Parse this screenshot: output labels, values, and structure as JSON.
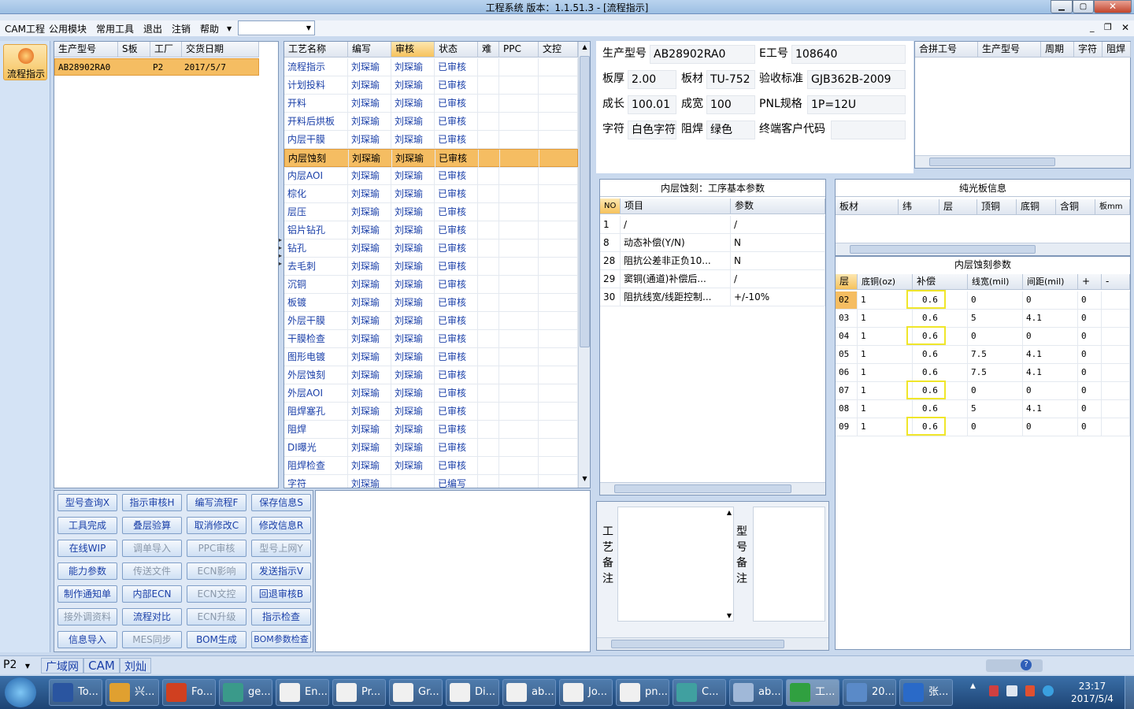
{
  "window": {
    "title": "工程系统   版本：1.1.51.3 - [流程指示]"
  },
  "menu": [
    "CAM工程",
    "公用模块",
    "常用工具",
    "退出",
    "注销",
    "帮助"
  ],
  "left_tool": {
    "label": "流程指示"
  },
  "order_table": {
    "headers": [
      "生产型号",
      "S板",
      "工厂",
      "交货日期"
    ],
    "row": [
      "AB28902RA0",
      "",
      "P2",
      "2017/5/7"
    ]
  },
  "process_table": {
    "headers": [
      "工艺名称",
      "编写",
      "审核",
      "状态",
      "难",
      "PPC",
      "文控"
    ],
    "rows": [
      [
        "流程指示",
        "刘琛瑜",
        "刘琛瑜",
        "已审核"
      ],
      [
        "计划投料",
        "刘琛瑜",
        "刘琛瑜",
        "已审核"
      ],
      [
        "开料",
        "刘琛瑜",
        "刘琛瑜",
        "已审核"
      ],
      [
        "开料后烘板",
        "刘琛瑜",
        "刘琛瑜",
        "已审核"
      ],
      [
        "内层干膜",
        "刘琛瑜",
        "刘琛瑜",
        "已审核"
      ],
      [
        "内层蚀刻",
        "刘琛瑜",
        "刘琛瑜",
        "已审核"
      ],
      [
        "内层AOI",
        "刘琛瑜",
        "刘琛瑜",
        "已审核"
      ],
      [
        "棕化",
        "刘琛瑜",
        "刘琛瑜",
        "已审核"
      ],
      [
        "层压",
        "刘琛瑜",
        "刘琛瑜",
        "已审核"
      ],
      [
        "铝片钻孔",
        "刘琛瑜",
        "刘琛瑜",
        "已审核"
      ],
      [
        "钻孔",
        "刘琛瑜",
        "刘琛瑜",
        "已审核"
      ],
      [
        "去毛刺",
        "刘琛瑜",
        "刘琛瑜",
        "已审核"
      ],
      [
        "沉铜",
        "刘琛瑜",
        "刘琛瑜",
        "已审核"
      ],
      [
        "板镀",
        "刘琛瑜",
        "刘琛瑜",
        "已审核"
      ],
      [
        "外层干膜",
        "刘琛瑜",
        "刘琛瑜",
        "已审核"
      ],
      [
        "干膜检查",
        "刘琛瑜",
        "刘琛瑜",
        "已审核"
      ],
      [
        "图形电镀",
        "刘琛瑜",
        "刘琛瑜",
        "已审核"
      ],
      [
        "外层蚀刻",
        "刘琛瑜",
        "刘琛瑜",
        "已审核"
      ],
      [
        "外层AOI",
        "刘琛瑜",
        "刘琛瑜",
        "已审核"
      ],
      [
        "阻焊塞孔",
        "刘琛瑜",
        "刘琛瑜",
        "已审核"
      ],
      [
        "阻焊",
        "刘琛瑜",
        "刘琛瑜",
        "已审核"
      ],
      [
        "DI曝光",
        "刘琛瑜",
        "刘琛瑜",
        "已审核"
      ],
      [
        "阻焊检查",
        "刘琛瑜",
        "刘琛瑜",
        "已审核"
      ],
      [
        "字符",
        "刘琛瑜",
        "",
        "已编写"
      ]
    ],
    "selected_index": 5
  },
  "buttons": [
    [
      "型号查询X",
      "指示审核H",
      "编写流程F",
      "保存信息S"
    ],
    [
      "工具完成",
      "叠层验算",
      "取消修改C",
      "修改信息R"
    ],
    [
      "在线WIP",
      "调单导入",
      "PPC审核",
      "型号上网Y"
    ],
    [
      "能力参数",
      "传送文件",
      "ECN影响",
      "发送指示V"
    ],
    [
      "制作通知单",
      "内部ECN",
      "ECN文控",
      "回退审核B"
    ],
    [
      "接外调资料",
      "流程对比",
      "ECN升级",
      "指示检查"
    ],
    [
      "信息导入",
      "MES同步",
      "BOM生成",
      "BOM参数检查"
    ]
  ],
  "buttons_disabled": [
    [
      2,
      1
    ],
    [
      2,
      2
    ],
    [
      2,
      3
    ],
    [
      3,
      1
    ],
    [
      3,
      2
    ],
    [
      4,
      2
    ],
    [
      5,
      0
    ],
    [
      5,
      2
    ],
    [
      6,
      1
    ]
  ],
  "info": {
    "prod_label": "生产型号",
    "prod": "AB28902RA0",
    "eno_label": "E工号",
    "eno": "108640",
    "thick_label": "板厚",
    "thick": "2.00",
    "mat_label": "板材",
    "mat": "TU-752",
    "std_label": "验收标准",
    "std": "GJB362B-2009",
    "len_label": "成长",
    "len": "100.01",
    "wid_label": "成宽",
    "wid": "100",
    "pnl_label": "PNL规格",
    "pnl": "1P=12U",
    "char_label": "字符",
    "char": "白色字符",
    "mask_label": "阻焊",
    "mask": "绿色",
    "end_label": "终端客户代码",
    "end": ""
  },
  "merge_table": {
    "headers": [
      "合拼工号",
      "生产型号",
      "周期",
      "字符",
      "阻焊"
    ]
  },
  "base_params": {
    "title": "内层蚀刻：工序基本参数",
    "headers": [
      "NO",
      "项目",
      "参数"
    ],
    "rows": [
      [
        "1",
        "/",
        "/"
      ],
      [
        "8",
        "动态补偿(Y/N)",
        "N"
      ],
      [
        "28",
        "阻抗公差非正负10...",
        "N"
      ],
      [
        "29",
        "窦铜(通道)补偿后...",
        "/"
      ],
      [
        "30",
        "阻抗线宽/线距控制...",
        "+/-10%"
      ]
    ]
  },
  "bare_board": {
    "title": "纯光板信息",
    "headers": [
      "板材",
      "纬",
      "层",
      "顶铜",
      "底铜",
      "含铜",
      "板mm"
    ]
  },
  "etch_params": {
    "title": "内层蚀刻参数",
    "headers": [
      "层",
      "底铜(oz)",
      "补偿",
      "线宽(mil)",
      "间距(mil)",
      "+",
      "-"
    ],
    "rows": [
      [
        "02",
        "1",
        "0.6",
        "0",
        "0",
        "0",
        ""
      ],
      [
        "03",
        "1",
        "0.6",
        "5",
        "4.1",
        "0",
        ""
      ],
      [
        "04",
        "1",
        "0.6",
        "0",
        "0",
        "0",
        ""
      ],
      [
        "05",
        "1",
        "0.6",
        "7.5",
        "4.1",
        "0",
        ""
      ],
      [
        "06",
        "1",
        "0.6",
        "7.5",
        "4.1",
        "0",
        ""
      ],
      [
        "07",
        "1",
        "0.6",
        "0",
        "0",
        "0",
        ""
      ],
      [
        "08",
        "1",
        "0.6",
        "5",
        "4.1",
        "0",
        ""
      ],
      [
        "09",
        "1",
        "0.6",
        "0",
        "0",
        "0",
        ""
      ]
    ],
    "highlighted_rows": [
      0,
      2,
      5,
      7
    ]
  },
  "remarks": {
    "process": "工艺备注",
    "model": "型号备注"
  },
  "status_bar": {
    "combo": "P2",
    "items": [
      "广域网",
      "CAM",
      "刘灿"
    ]
  },
  "taskbar": {
    "items": [
      "To...",
      "兴...",
      "Fo...",
      "ge...",
      "En...",
      "Pr...",
      "Gr...",
      "Di...",
      "ab...",
      "Jo...",
      "pn...",
      "C...",
      "ab...",
      "工...",
      "20...",
      "张..."
    ],
    "time": "23:17",
    "date": "2017/5/4"
  }
}
